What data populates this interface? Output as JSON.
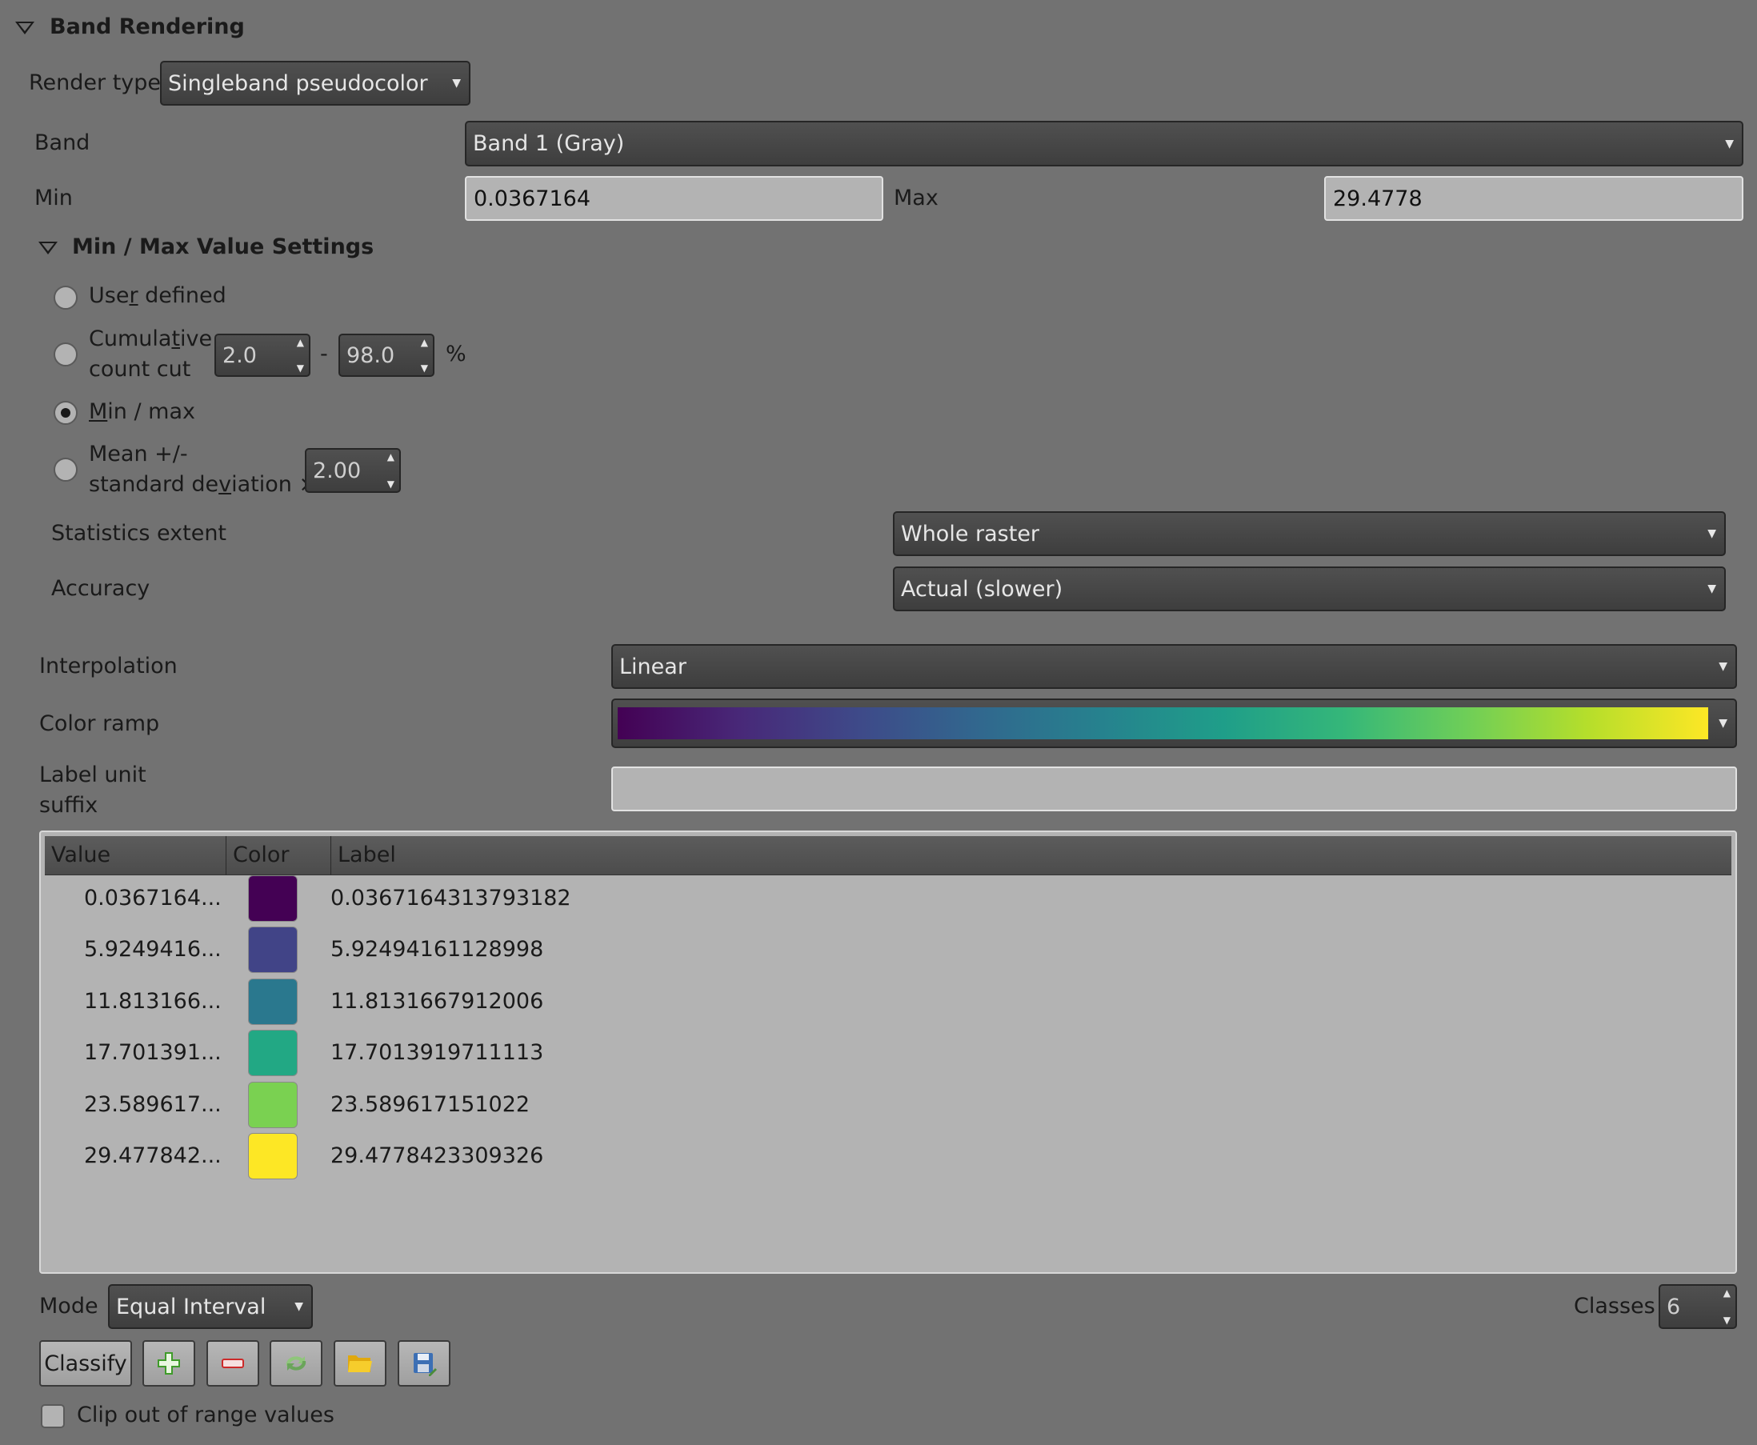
{
  "section": {
    "title": "Band Rendering"
  },
  "render_type": {
    "label": "Render type",
    "value": "Singleband pseudocolor"
  },
  "band": {
    "label": "Band",
    "value": "Band 1 (Gray)"
  },
  "min": {
    "label": "Min",
    "value": "0.0367164"
  },
  "max": {
    "label": "Max",
    "value": "29.4778"
  },
  "minmax_settings": {
    "title": "Min / Max Value Settings",
    "user_defined": {
      "pre": "Use",
      "ul": "r",
      "post": " defined",
      "checked": false
    },
    "cumulative": {
      "line1_pre": "Cumula",
      "line1_ul": "t",
      "line1_post": "ive",
      "line2": "count cut",
      "low": "2.0",
      "dash": "-",
      "high": "98.0",
      "percent": "%",
      "checked": false
    },
    "minmax": {
      "ul": "M",
      "post": "in / max",
      "checked": true
    },
    "mean_std": {
      "line1": "Mean +/-",
      "line2_pre": "standard de",
      "line2_ul": "v",
      "line2_post": "iation ×",
      "value": "2.00",
      "checked": false
    },
    "statistics_extent": {
      "label": "Statistics extent",
      "value": "Whole raster"
    },
    "accuracy": {
      "label": "Accuracy",
      "value": "Actual (slower)"
    }
  },
  "interpolation": {
    "label": "Interpolation",
    "value": "Linear"
  },
  "color_ramp": {
    "label": "Color ramp",
    "stops": [
      "#440154",
      "#482878",
      "#3e4a89",
      "#31688e",
      "#26828e",
      "#1f9e89",
      "#35b779",
      "#6ece58",
      "#b5de2b",
      "#fde725"
    ]
  },
  "label_unit_suffix": {
    "label_line1": "Label unit",
    "label_line2": "suffix",
    "value": ""
  },
  "table": {
    "headers": {
      "value": "Value",
      "color": "Color",
      "label": "Label"
    },
    "rows": [
      {
        "value": "0.0367164...",
        "color": "#440154",
        "label": "0.0367164313793182"
      },
      {
        "value": "5.9249416...",
        "color": "#414487",
        "label": "5.92494161128998"
      },
      {
        "value": "11.813166...",
        "color": "#2a788e",
        "label": "11.8131667912006"
      },
      {
        "value": "17.701391...",
        "color": "#22a884",
        "label": "17.7013919711113"
      },
      {
        "value": "23.589617...",
        "color": "#7ad151",
        "label": "23.589617151022"
      },
      {
        "value": "29.477842...",
        "color": "#fde725",
        "label": "29.4778423309326"
      }
    ]
  },
  "mode": {
    "label": "Mode",
    "value": "Equal Interval"
  },
  "classes": {
    "label": "Classes",
    "value": "6"
  },
  "buttons": {
    "classify": "Classify"
  },
  "clip": {
    "label": "Clip out of range values",
    "checked": false
  }
}
